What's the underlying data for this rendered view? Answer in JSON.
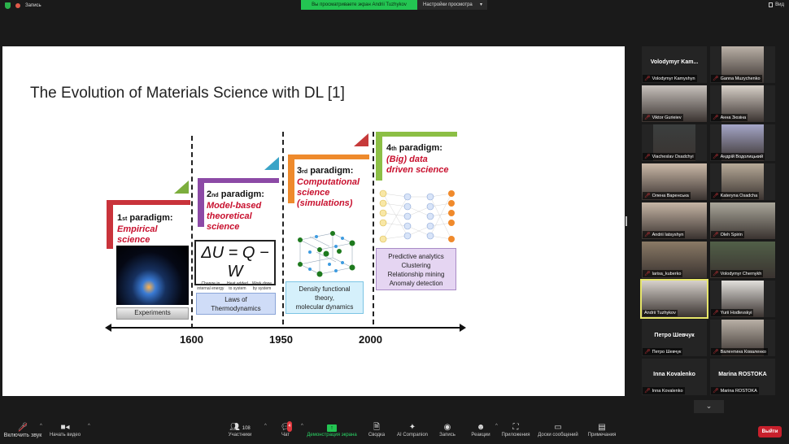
{
  "topbar": {
    "recording": "Запись",
    "banner": "Вы просматриваете экран Andrii Tuzhykov",
    "view_options": "Настройки просмотра",
    "view": "Вид"
  },
  "slide": {
    "title": "The Evolution of Materials Science with DL [1]",
    "years": [
      "1600",
      "1950",
      "2000"
    ],
    "p1": {
      "num": "1",
      "ord": "st",
      "label": "paradigm:",
      "desc1": "Empirical",
      "desc2": "science",
      "box": "Experiments"
    },
    "p2": {
      "num": "2",
      "ord": "nd",
      "label": "paradigm:",
      "desc1": "Model-based",
      "desc2": "theoretical",
      "desc3": "science",
      "equation": "ΔU = Q − W",
      "eq_terms": [
        "Change in internal energy",
        "Heat added to system",
        "Work done by system"
      ],
      "box1": "Laws of",
      "box2": "Thermodynamics"
    },
    "p3": {
      "num": "3",
      "ord": "rd",
      "label": "paradigm:",
      "desc1": "Computational",
      "desc2": "science",
      "desc3": "(simulations)",
      "box1": "Density functional",
      "box2": "theory,",
      "box3": "molecular dynamics"
    },
    "p4": {
      "num": "4",
      "ord": "th",
      "label": "paradigm:",
      "desc1": "(Big) data",
      "desc2": "driven science",
      "box": [
        "Predictive analytics",
        "Clustering",
        "Relationship mining",
        "Anomaly detection"
      ]
    }
  },
  "participants": [
    {
      "name": "Volodymyr Kamyshyn",
      "display": "Volodymyr  Kam...",
      "muted": true
    },
    {
      "name": "Ganna Muzychenko",
      "muted": true,
      "photo": true
    },
    {
      "name": "Viktor Gurieiev",
      "muted": true,
      "photo": true
    },
    {
      "name": "Анна Зюзіна",
      "muted": true,
      "photo": true
    },
    {
      "name": "Viacheslav Osadchyi",
      "muted": true,
      "photo": true
    },
    {
      "name": "Андрій Водолицький",
      "muted": true,
      "photo": true
    },
    {
      "name": "Олена Варенська",
      "muted": true,
      "photo": true
    },
    {
      "name": "Kateryna Osadcha",
      "muted": true,
      "photo": true
    },
    {
      "name": "Andrii Iatsyshyn",
      "muted": true,
      "photo": true
    },
    {
      "name": "Oleh Spirin",
      "muted": true,
      "photo": true
    },
    {
      "name": "larisa_kuberko",
      "muted": true,
      "photo": true
    },
    {
      "name": "Volodymyr Chernykh",
      "muted": true,
      "photo": true
    },
    {
      "name": "Andrii Tuzhykov",
      "muted": false,
      "photo": true,
      "active": true
    },
    {
      "name": "Yurii Hodlevskyi",
      "muted": true,
      "photo": true
    },
    {
      "name": "Петро Шевчук",
      "display": "Петро Шевчук",
      "muted": true
    },
    {
      "name": "Валентина Коваленко",
      "muted": true,
      "photo": true
    },
    {
      "name": "Inna Kovalenko",
      "display": "Inna Kovalenko",
      "muted": true
    },
    {
      "name": "Marina ROSTOKA",
      "display": "Marina ROSTOKA",
      "muted": true
    }
  ],
  "toolbar": {
    "unmute": "Включить звук",
    "video": "Начать видео",
    "participants": "Участники",
    "participants_count": "108",
    "chat": "Чат",
    "chat_badge": "4",
    "share": "Демонстрация экрана",
    "summary": "Сводка",
    "ai": "AI Companion",
    "record": "Запись",
    "reactions": "Реакции",
    "apps": "Приложения",
    "whiteboards": "Доски сообщений",
    "notes": "Примечания",
    "leave": "Выйти"
  },
  "colors": {
    "share_green": "#23c552",
    "leave_red": "#c8202c",
    "emphasis_red": "#c8102e"
  }
}
